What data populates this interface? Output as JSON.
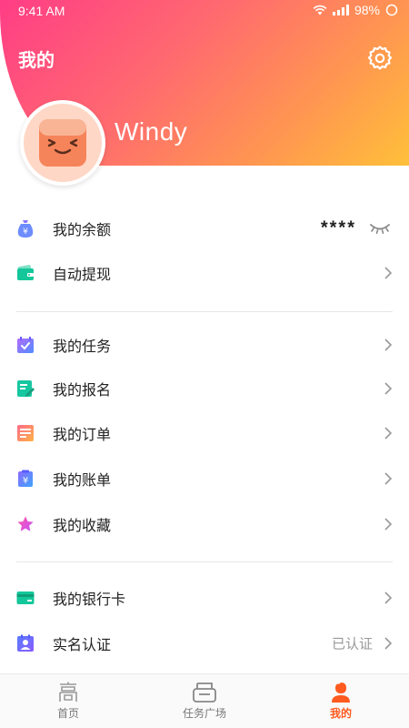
{
  "status_bar": {
    "time": "9:41 AM",
    "battery": "98%"
  },
  "header": {
    "title": "我的",
    "username": "Windy"
  },
  "menu": {
    "balance": {
      "label": "我的余额",
      "value_masked": "****"
    },
    "auto_withdraw": {
      "label": "自动提现"
    },
    "tasks": {
      "label": "我的任务"
    },
    "signups": {
      "label": "我的报名"
    },
    "orders": {
      "label": "我的订单"
    },
    "bills": {
      "label": "我的账单"
    },
    "favorites": {
      "label": "我的收藏"
    },
    "bank_card": {
      "label": "我的银行卡"
    },
    "real_name": {
      "label": "实名认证",
      "status": "已认证"
    }
  },
  "tabbar": {
    "tabs": [
      {
        "label": "首页",
        "icon": "home-icon"
      },
      {
        "label": "任务广场",
        "icon": "task-plaza-icon"
      },
      {
        "label": "我的",
        "icon": "profile-icon",
        "active": true
      }
    ]
  },
  "colors": {
    "header_gradient": [
      "#ff3d86",
      "#ff9a4e",
      "#ffc03a"
    ],
    "accent": "#ff5a1f"
  }
}
